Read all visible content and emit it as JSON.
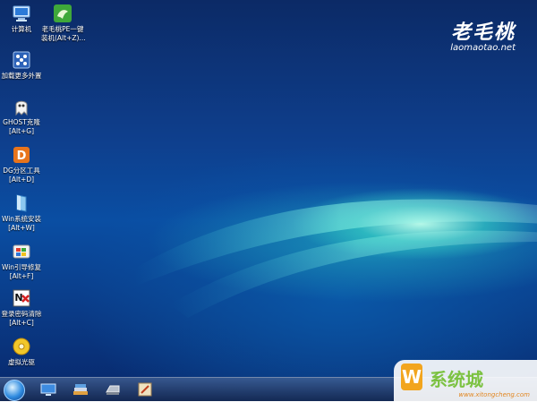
{
  "brand": {
    "name": "老毛桃",
    "url": "laomaotao.net"
  },
  "desktop_icons": [
    {
      "label": "计算机",
      "shortcut": "",
      "icon": "computer-icon"
    },
    {
      "label": "老毛桃PE一键",
      "shortcut": "装机(Alt+Z)...",
      "icon": "pe-install-icon"
    },
    {
      "label": "加载更多外置",
      "shortcut": "",
      "icon": "load-more-icon"
    },
    {
      "label": "GHOST克隆",
      "shortcut": "[Alt+G]",
      "icon": "ghost-icon"
    },
    {
      "label": "DG分区工具",
      "shortcut": "[Alt+D]",
      "icon": "partition-tool-icon"
    },
    {
      "label": "Win系统安装",
      "shortcut": "[Alt+W]",
      "icon": "win-install-icon"
    },
    {
      "label": "Win引导修复",
      "shortcut": "[Alt+F]",
      "icon": "boot-repair-icon"
    },
    {
      "label": "登录密码清除",
      "shortcut": "[Alt+C]",
      "icon": "password-clear-icon"
    },
    {
      "label": "虚拟光驱",
      "shortcut": "",
      "icon": "virtual-drive-icon"
    }
  ],
  "taskbar": {
    "items": [
      "start-orb-icon",
      "monitor-icon",
      "books-icon",
      "drive-icon",
      "tool-icon"
    ]
  },
  "watermark": {
    "logo_letter": "W",
    "text": "系统城",
    "url": "www.xitongcheng.com"
  },
  "colors": {
    "desktop": "#0a4ea3",
    "glow": "#5fe0d0",
    "taskbar": "#2a4a80",
    "watermark_orange": "#f2a51e",
    "watermark_green": "#7cc242"
  }
}
